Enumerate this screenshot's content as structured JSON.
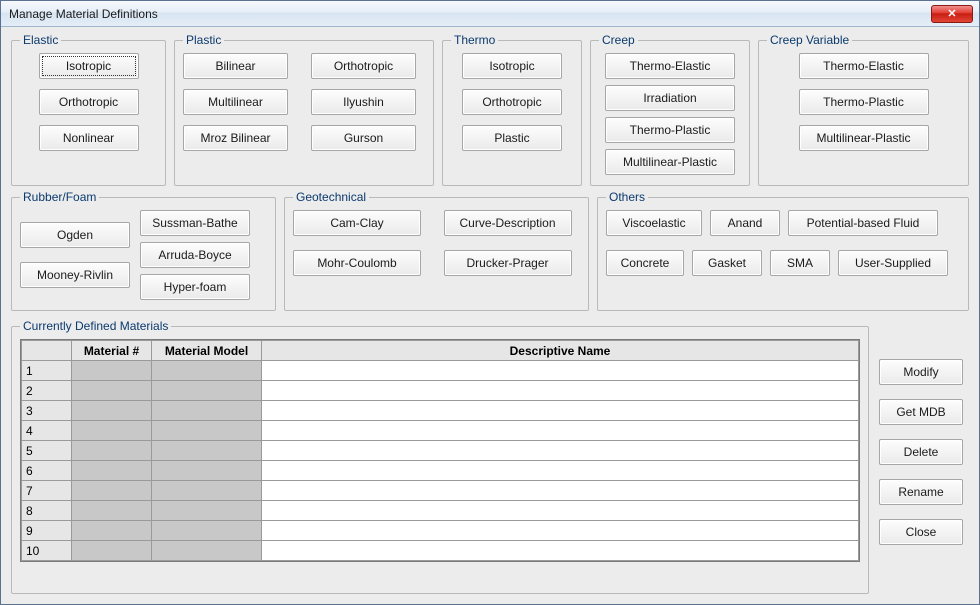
{
  "window": {
    "title": "Manage Material Definitions"
  },
  "groups": {
    "elastic": {
      "legend": "Elastic",
      "buttons": [
        "Isotropic",
        "Orthotropic",
        "Nonlinear"
      ]
    },
    "plastic": {
      "legend": "Plastic",
      "buttons": [
        "Bilinear",
        "Orthotropic",
        "Multilinear",
        "Ilyushin",
        "Mroz Bilinear",
        "Gurson"
      ]
    },
    "thermo": {
      "legend": "Thermo",
      "buttons": [
        "Isotropic",
        "Orthotropic",
        "Plastic"
      ]
    },
    "creep": {
      "legend": "Creep",
      "buttons": [
        "Thermo-Elastic",
        "Irradiation",
        "Thermo-Plastic",
        "Multilinear-Plastic"
      ]
    },
    "creepvar": {
      "legend": "Creep Variable",
      "buttons": [
        "Thermo-Elastic",
        "Thermo-Plastic",
        "Multilinear-Plastic"
      ]
    },
    "rubber": {
      "legend": "Rubber/Foam",
      "colA": [
        "Ogden",
        "Mooney-Rivlin"
      ],
      "colB": [
        "Sussman-Bathe",
        "Arruda-Boyce",
        "Hyper-foam"
      ]
    },
    "geo": {
      "legend": "Geotechnical",
      "buttons": [
        "Cam-Clay",
        "Curve-Description",
        "Mohr-Coulomb",
        "Drucker-Prager"
      ]
    },
    "others": {
      "legend": "Others",
      "row1": [
        "Viscoelastic",
        "Anand",
        "Potential-based Fluid"
      ],
      "row2": [
        "Concrete",
        "Gasket",
        "SMA",
        "User-Supplied"
      ]
    }
  },
  "table": {
    "legend": "Currently Defined Materials",
    "headers": [
      "Material #",
      "Material Model",
      "Descriptive Name"
    ],
    "rows": [
      {
        "n": "1",
        "mat": "",
        "model": "",
        "desc": ""
      },
      {
        "n": "2",
        "mat": "",
        "model": "",
        "desc": ""
      },
      {
        "n": "3",
        "mat": "",
        "model": "",
        "desc": ""
      },
      {
        "n": "4",
        "mat": "",
        "model": "",
        "desc": ""
      },
      {
        "n": "5",
        "mat": "",
        "model": "",
        "desc": ""
      },
      {
        "n": "6",
        "mat": "",
        "model": "",
        "desc": ""
      },
      {
        "n": "7",
        "mat": "",
        "model": "",
        "desc": ""
      },
      {
        "n": "8",
        "mat": "",
        "model": "",
        "desc": ""
      },
      {
        "n": "9",
        "mat": "",
        "model": "",
        "desc": ""
      },
      {
        "n": "10",
        "mat": "",
        "model": "",
        "desc": ""
      }
    ]
  },
  "side": {
    "buttons": [
      "Modify",
      "Get MDB",
      "Delete",
      "Rename",
      "Close"
    ]
  },
  "focused_button": "elastic.0"
}
